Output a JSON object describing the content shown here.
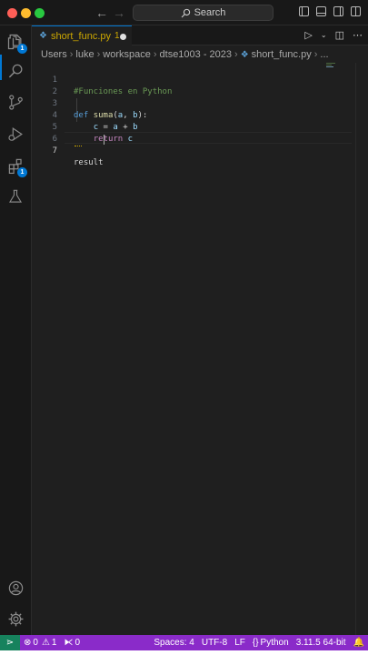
{
  "window": {
    "search_label": "Search"
  },
  "tab": {
    "filename": "short_func.py",
    "problem_count": "1"
  },
  "activity": {
    "explorer_badge": "1",
    "extensions_badge": "1"
  },
  "breadcrumb": {
    "parts": [
      "Users",
      "luke",
      "workspace",
      "dtse1003 - 2023",
      "short_func.py",
      "..."
    ]
  },
  "editor": {
    "lines": [
      {
        "number": "1",
        "text": "#Funciones en Python"
      },
      {
        "number": "2",
        "text": ""
      },
      {
        "number": "3",
        "text": "def suma(a, b):"
      },
      {
        "number": "4",
        "text": "    c = a + b"
      },
      {
        "number": "5",
        "text": "    return c"
      },
      {
        "number": "6",
        "text": ""
      },
      {
        "number": "7",
        "text": "result"
      }
    ],
    "active_line": "7"
  },
  "status": {
    "errors": "0",
    "warnings": "1",
    "ports": "0",
    "spaces": "Spaces: 4",
    "encoding": "UTF-8",
    "eol": "LF",
    "language": "Python",
    "interpreter": "3.11.5 64-bit",
    "accent": "#8a2bc9",
    "remote_color": "#16825d"
  }
}
